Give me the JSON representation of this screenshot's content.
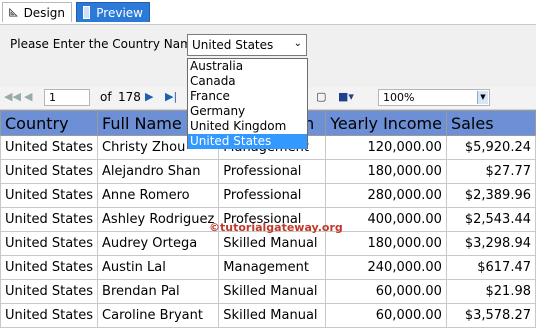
{
  "tabs": {
    "design_label": "Design",
    "preview_label": "Preview"
  },
  "parameter": {
    "label": "Please Enter the Country Name",
    "selected_value": "United States",
    "options": [
      "Australia",
      "Canada",
      "France",
      "Germany",
      "United Kingdom",
      "United States"
    ]
  },
  "toolbar": {
    "current_page": "1",
    "of_label": "of",
    "total_pages": "178",
    "zoom": "100%"
  },
  "watermark": "©tutorialgateway.org",
  "report": {
    "columns": [
      "Country",
      "Full Name",
      "Occupation",
      "Yearly Income",
      "Sales"
    ],
    "rows": [
      [
        "United States",
        "Christy Zhou",
        "Management",
        "120,000.00",
        "$5,920.24"
      ],
      [
        "United States",
        "Alejandro Shan",
        "Professional",
        "180,000.00",
        "$27.77"
      ],
      [
        "United States",
        "Anne Romero",
        "Professional",
        "280,000.00",
        "$2,389.96"
      ],
      [
        "United States",
        "Ashley Rodriguez",
        "Professional",
        "400,000.00",
        "$2,543.44"
      ],
      [
        "United States",
        "Audrey Ortega",
        "Skilled Manual",
        "180,000.00",
        "$3,298.94"
      ],
      [
        "United States",
        "Austin Lal",
        "Management",
        "240,000.00",
        "$617.47"
      ],
      [
        "United States",
        "Brendan Pal",
        "Skilled Manual",
        "60,000.00",
        "$21.98"
      ],
      [
        "United States",
        "Caroline Bryant",
        "Skilled Manual",
        "60,000.00",
        "$3,578.27"
      ]
    ]
  }
}
